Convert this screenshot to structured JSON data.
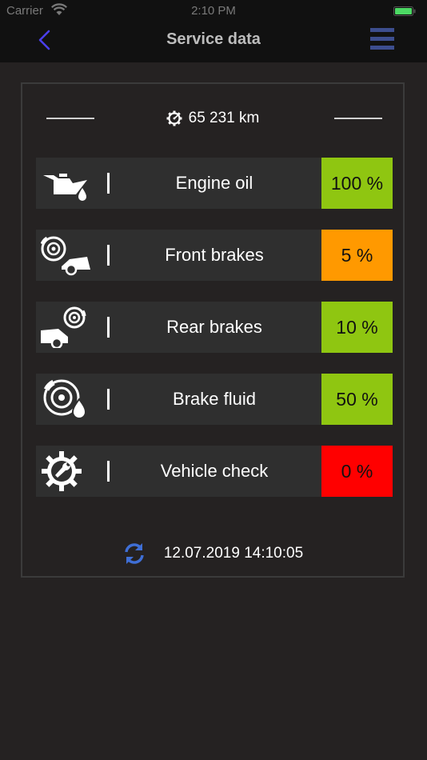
{
  "status": {
    "carrier": "Carrier",
    "time": "2:10 PM"
  },
  "nav": {
    "title": "Service data",
    "back_icon": "chevron-left-icon",
    "menu_icon": "hamburger-menu-icon"
  },
  "odometer": {
    "value": "65 231 km"
  },
  "items": [
    {
      "label": "Engine oil",
      "percent_text": "100 %",
      "percent": 100,
      "color": "#8fc611",
      "icon": "oil-can-icon"
    },
    {
      "label": "Front brakes",
      "percent_text": "5 %",
      "percent": 5,
      "color": "#ff9900",
      "icon": "front-brake-icon"
    },
    {
      "label": "Rear brakes",
      "percent_text": "10 %",
      "percent": 10,
      "color": "#8fc611",
      "icon": "rear-brake-icon"
    },
    {
      "label": "Brake fluid",
      "percent_text": "50 %",
      "percent": 50,
      "color": "#8fc611",
      "icon": "brake-fluid-icon"
    },
    {
      "label": "Vehicle check",
      "percent_text": "0 %",
      "percent": 0,
      "color": "#ff0000",
      "icon": "vehicle-check-icon"
    }
  ],
  "last_update": {
    "timestamp": "12.07.2019 14:10:05"
  },
  "colors": {
    "accent": "#3f6fd6",
    "background": "#252222",
    "row": "#2f2f2f"
  }
}
